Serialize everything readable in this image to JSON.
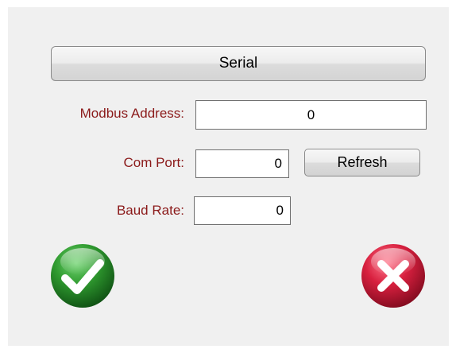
{
  "mode": {
    "label": "Serial"
  },
  "fields": {
    "modbus_address": {
      "label": "Modbus Address:",
      "value": "0"
    },
    "com_port": {
      "label": "Com Port:",
      "value": "0"
    },
    "baud_rate": {
      "label": "Baud Rate:",
      "value": "0"
    }
  },
  "buttons": {
    "refresh": "Refresh",
    "ok_icon": "checkmark-icon",
    "cancel_icon": "x-cross-icon"
  },
  "colors": {
    "label_text": "#8b1a1a",
    "ok_green": "#2e8b2e",
    "cancel_red": "#d0213f",
    "panel_bg": "#f0f0f0"
  }
}
